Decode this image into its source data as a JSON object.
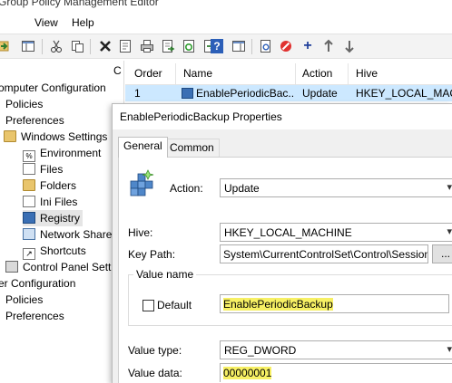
{
  "window": {
    "title": "Group Policy Management Editor"
  },
  "menu": {
    "items": [
      "View",
      "Help"
    ]
  },
  "toolbar": {
    "buttons": [
      "forward-icon",
      "show-hide-tree-icon",
      "cut-icon",
      "copy-icon",
      "delete-icon",
      "properties-icon",
      "print-icon",
      "export-icon",
      "refresh-icon",
      "export-list-icon",
      "help-icon",
      "action-pane-icon",
      "search-icon",
      "stop-icon",
      "add-icon",
      "up-icon",
      "down-icon"
    ]
  },
  "tree": {
    "items": [
      {
        "label": "omputer Configuration",
        "indent": 0,
        "icon": "none"
      },
      {
        "label": "Policies",
        "indent": 1,
        "icon": "none"
      },
      {
        "label": "Preferences",
        "indent": 1,
        "icon": "none"
      },
      {
        "label": "Windows Settings",
        "indent": 2,
        "icon": "folder-icon"
      },
      {
        "label": "Environment",
        "indent": 3,
        "icon": "environment-icon"
      },
      {
        "label": "Files",
        "indent": 3,
        "icon": "files-icon"
      },
      {
        "label": "Folders",
        "indent": 3,
        "icon": "folders-icon"
      },
      {
        "label": "Ini Files",
        "indent": 3,
        "icon": "ini-files-icon"
      },
      {
        "label": "Registry",
        "indent": 3,
        "icon": "registry-icon",
        "selected": true
      },
      {
        "label": "Network Share",
        "indent": 3,
        "icon": "network-shares-icon"
      },
      {
        "label": "Shortcuts",
        "indent": 3,
        "icon": "shortcuts-icon"
      },
      {
        "label": "Control Panel Setti",
        "indent": 2,
        "icon": "control-panel-icon"
      },
      {
        "label": "er Configuration",
        "indent": 0,
        "icon": "none"
      },
      {
        "label": "Policies",
        "indent": 1,
        "icon": "none"
      },
      {
        "label": "Preferences",
        "indent": 1,
        "icon": "none"
      }
    ]
  },
  "list": {
    "partial_col": "C",
    "headers": [
      "Order",
      "Name",
      "Action",
      "Hive"
    ],
    "row": {
      "order": "1",
      "name": "EnablePeriodicBac...",
      "action": "Update",
      "hive": "HKEY_LOCAL_MAC..."
    }
  },
  "dialog": {
    "title": "EnablePeriodicBackup Properties",
    "tabs": [
      "General",
      "Common"
    ],
    "action_label": "Action:",
    "action_value": "Update",
    "hive_label": "Hive:",
    "hive_value": "HKEY_LOCAL_MACHINE",
    "keypath_label": "Key Path:",
    "keypath_value": "System\\CurrentControlSet\\Control\\Session Ma",
    "browse_label": "...",
    "value_name_group": "Value name",
    "default_label": "Default",
    "default_checked": false,
    "value_name": "EnablePeriodicBackup",
    "value_type_label": "Value type:",
    "value_type": "REG_DWORD",
    "value_data_label": "Value data:",
    "value_data": "00000001"
  }
}
